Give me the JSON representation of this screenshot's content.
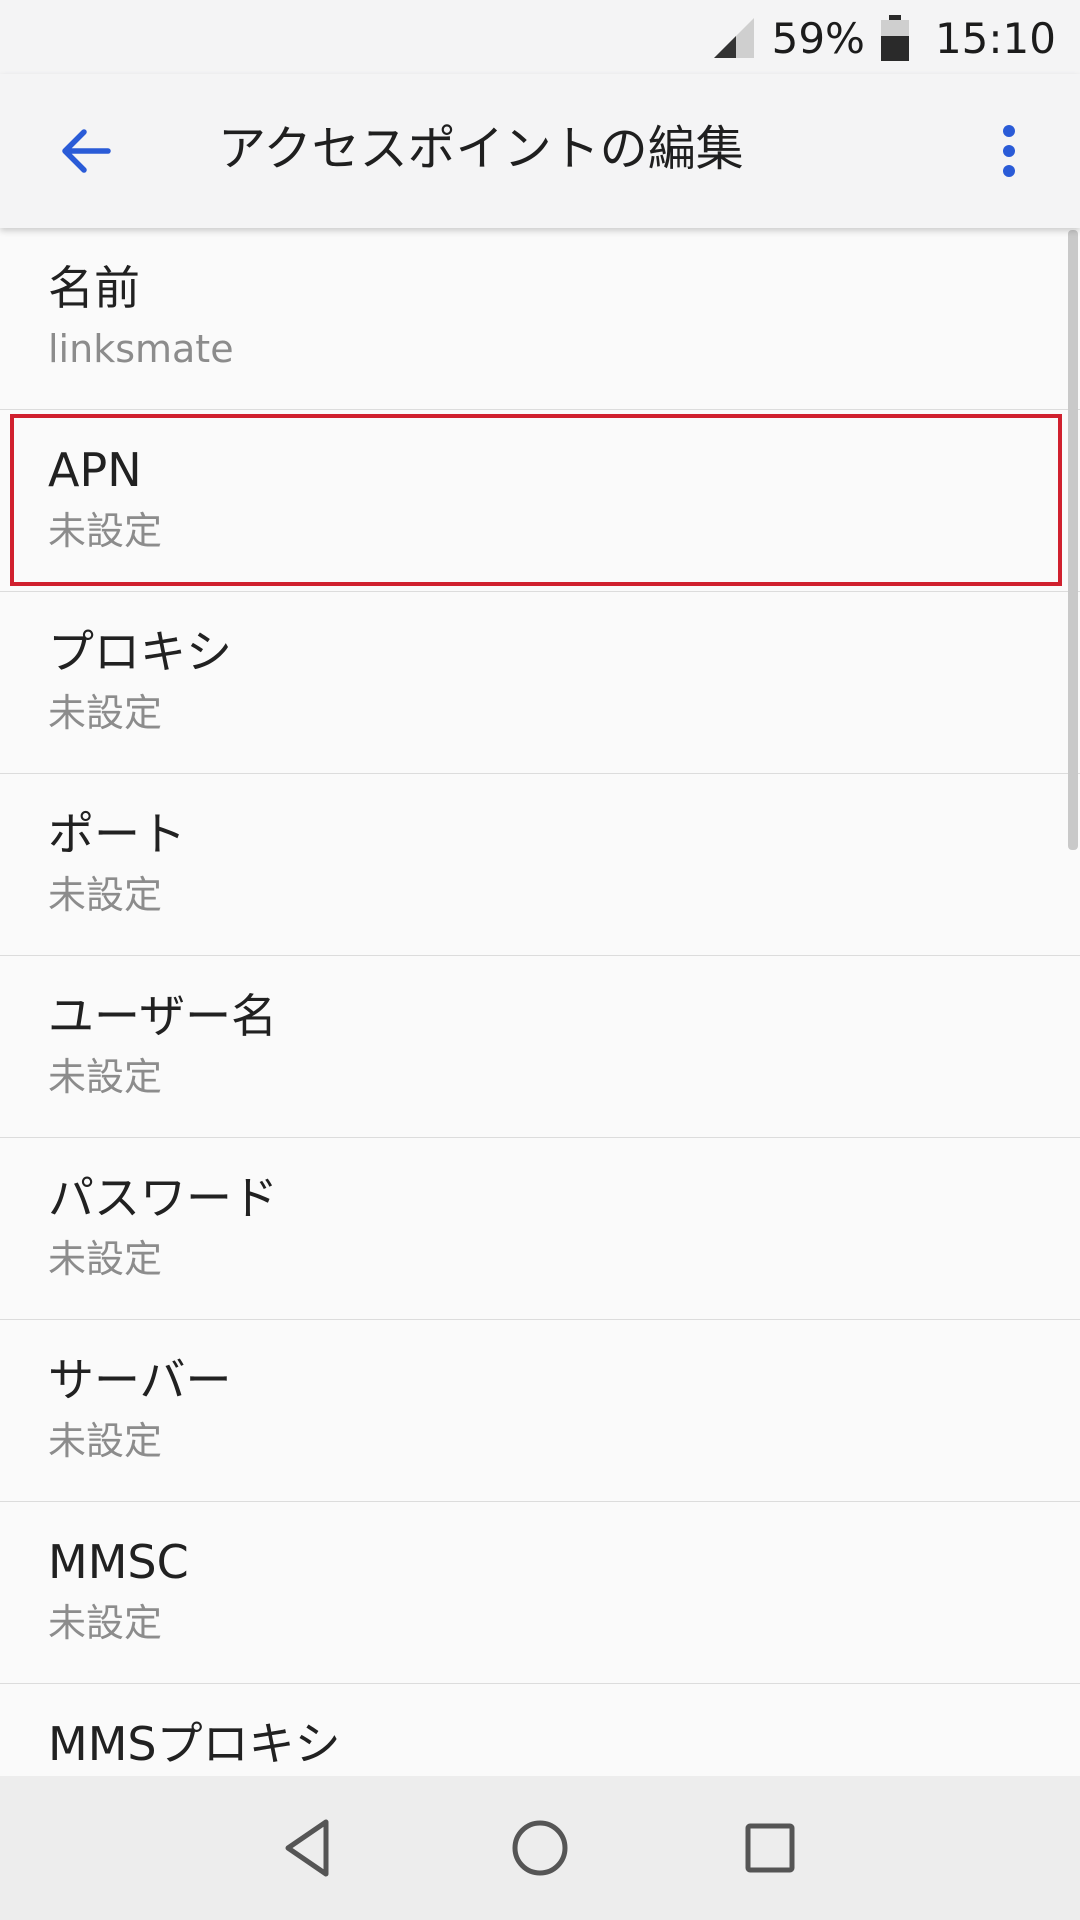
{
  "status_bar": {
    "battery_percent": "59%",
    "time": "15:10",
    "icons": [
      "signal-icon",
      "battery-icon"
    ]
  },
  "app_bar": {
    "title": "アクセスポイントの編集",
    "back_icon": "arrow-back-icon",
    "menu_icon": "more-vert-icon",
    "accent_color": "#2a5bd7"
  },
  "list": {
    "items": [
      {
        "title": "名前",
        "summary": "linksmate"
      },
      {
        "title": "APN",
        "summary": "未設定",
        "highlighted": true
      },
      {
        "title": "プロキシ",
        "summary": "未設定"
      },
      {
        "title": "ポート",
        "summary": "未設定"
      },
      {
        "title": "ユーザー名",
        "summary": "未設定"
      },
      {
        "title": "パスワード",
        "summary": "未設定"
      },
      {
        "title": "サーバー",
        "summary": "未設定"
      },
      {
        "title": "MMSC",
        "summary": "未設定"
      },
      {
        "title": "MMSプロキシ",
        "summary": ""
      }
    ],
    "highlight_color": "#d0202e"
  },
  "nav_bar": {
    "icons": [
      "back-triangle-icon",
      "home-circle-icon",
      "recents-square-icon"
    ]
  }
}
